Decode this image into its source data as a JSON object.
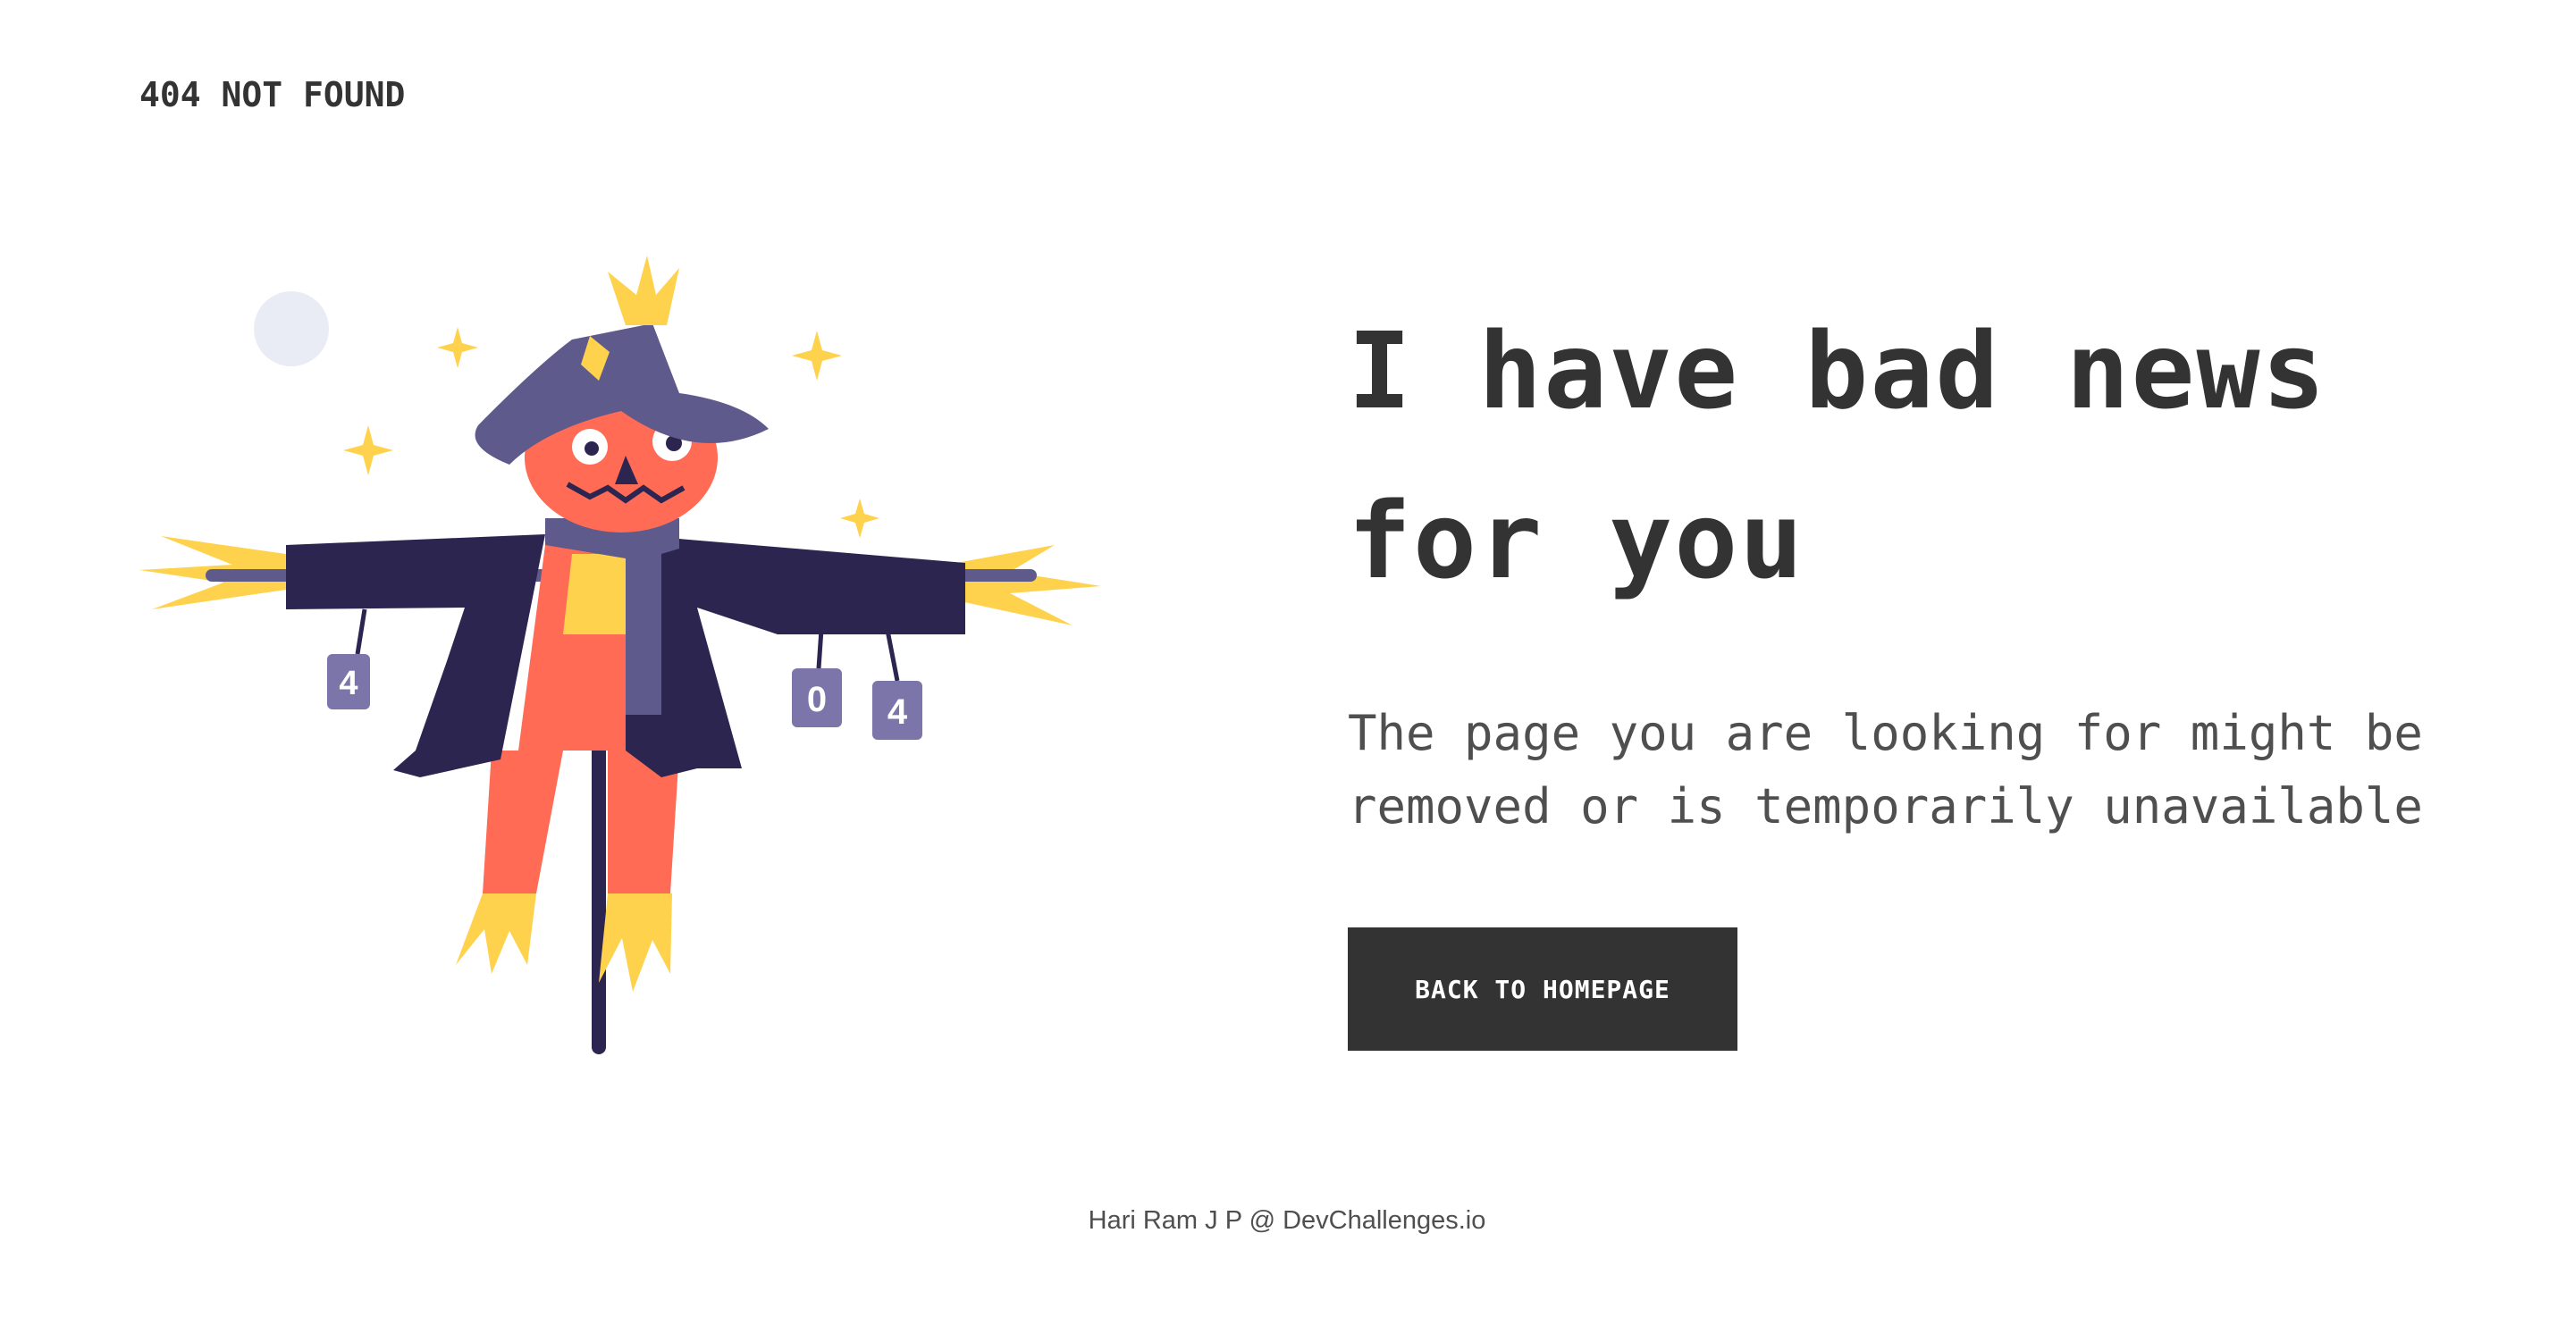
{
  "header": {
    "brand": "404 NOT FOUND"
  },
  "main": {
    "headline": "I have bad news for you",
    "description": "The page you are looking for might be removed or is temporarily unavailable",
    "back_button_label": "BACK TO HOMEPAGE"
  },
  "illustration": {
    "subject": "scarecrow",
    "cans": [
      "4",
      "0",
      "4"
    ]
  },
  "footer": {
    "credit": "Hari Ram J P @ DevChallenges.io"
  },
  "colors": {
    "text": "#333333",
    "button_bg": "#333333",
    "button_text": "#ffffff",
    "hat": "#5e5a8c",
    "coat": "#2b2550",
    "skin": "#ff6b55",
    "straw": "#ffd24d",
    "moon": "#e9ecf5"
  }
}
